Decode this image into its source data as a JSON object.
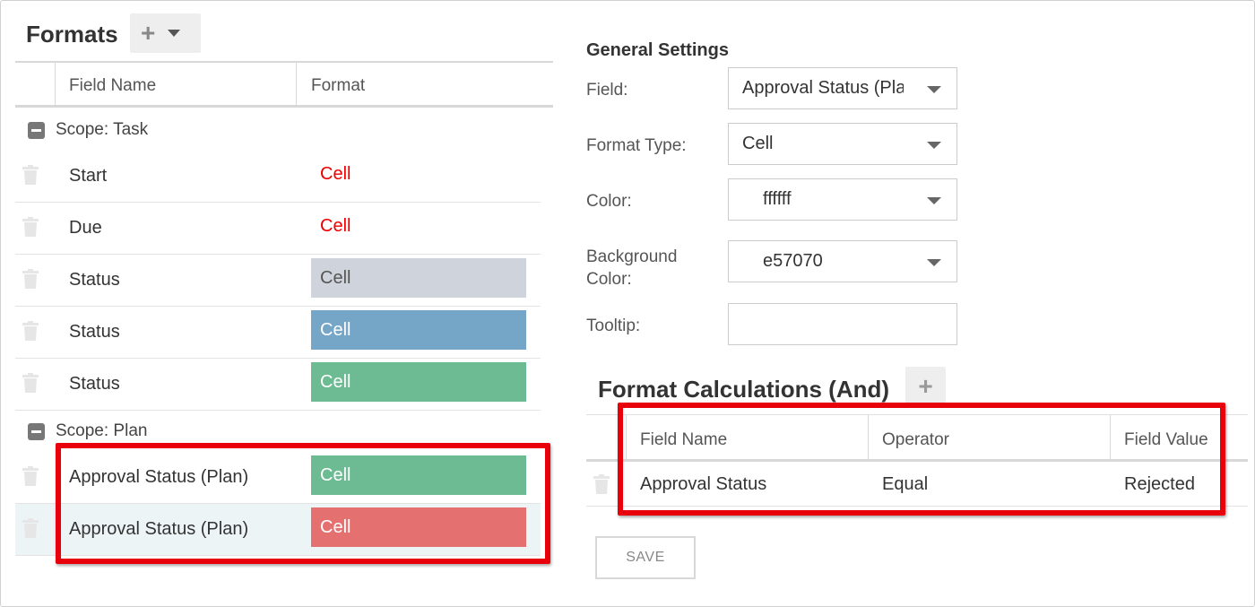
{
  "formats": {
    "title": "Formats",
    "add_button_icon": "plus-icon",
    "dropdown_icon": "caret-down-icon",
    "columns": [
      "Field Name",
      "Format"
    ],
    "scopes": [
      {
        "label": "Scope: Task",
        "rows": [
          {
            "field": "Start",
            "format": "Cell",
            "style": "text",
            "color": "#e00000",
            "bg": ""
          },
          {
            "field": "Due",
            "format": "Cell",
            "style": "text",
            "color": "#e00000",
            "bg": ""
          },
          {
            "field": "Status",
            "format": "Cell",
            "style": "fill",
            "color": "#555555",
            "bg": "#cfd3db"
          },
          {
            "field": "Status",
            "format": "Cell",
            "style": "fill",
            "color": "#ffffff",
            "bg": "#75a5c7"
          },
          {
            "field": "Status",
            "format": "Cell",
            "style": "fill",
            "color": "#ffffff",
            "bg": "#6dbb92"
          }
        ]
      },
      {
        "label": "Scope: Plan",
        "rows": [
          {
            "field": "Approval Status (Plan)",
            "format": "Cell",
            "style": "fill",
            "color": "#ffffff",
            "bg": "#6dbb92"
          },
          {
            "field": "Approval Status (Plan)",
            "format": "Cell",
            "style": "fill",
            "color": "#ffffff",
            "bg": "#e57070",
            "selected": true
          }
        ]
      }
    ]
  },
  "general_settings": {
    "title": "General Settings",
    "field_label": "Field:",
    "field_value": "Approval Status (Plan)",
    "format_type_label": "Format Type:",
    "format_type_value": "Cell",
    "color_label": "Color:",
    "color_value": "ffffff",
    "background_label_line1": "Background",
    "background_label_line2": "Color:",
    "background_value": "e57070",
    "tooltip_label": "Tooltip:",
    "tooltip_value": ""
  },
  "format_calculations": {
    "title": "Format Calculations (And)",
    "columns": [
      "Field Name",
      "Operator",
      "Field Value"
    ],
    "rows": [
      {
        "field": "Approval Status",
        "operator": "Equal",
        "value": "Rejected"
      }
    ]
  },
  "save_label": "SAVE",
  "colors": {
    "highlight": "#e8000b",
    "selected_row_bg": "#edf4f6"
  }
}
